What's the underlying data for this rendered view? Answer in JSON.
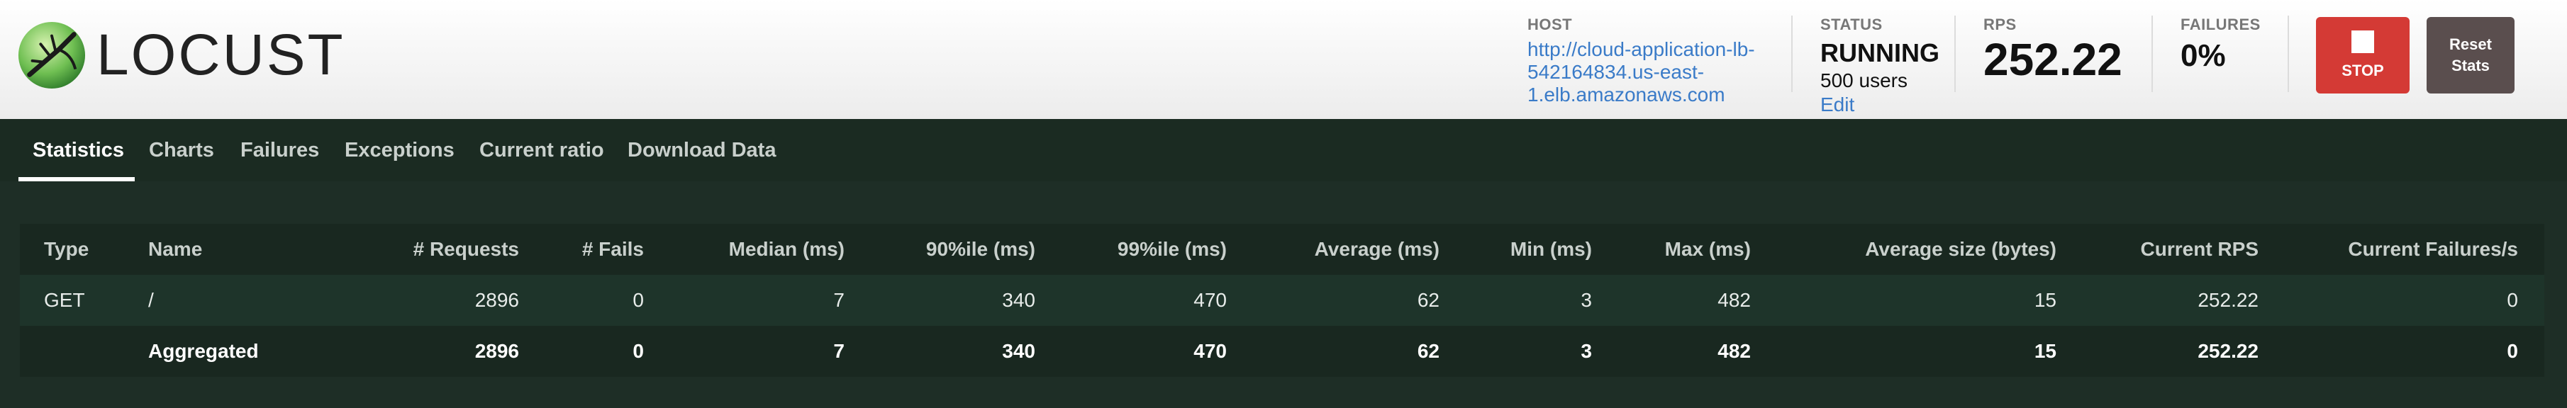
{
  "brand": {
    "name": "LOCUST"
  },
  "header": {
    "host": {
      "label": "HOST",
      "value": "http://cloud-application-lb-542164834.us-east-1.elb.amazonaws.com"
    },
    "status": {
      "label": "STATUS",
      "value": "RUNNING",
      "users": "500 users",
      "edit": "Edit"
    },
    "rps": {
      "label": "RPS",
      "value": "252.22"
    },
    "failures": {
      "label": "FAILURES",
      "value": "0%"
    },
    "stop_label": "STOP",
    "reset_label": "Reset\nStats"
  },
  "tabs": [
    {
      "label": "Statistics",
      "active": true
    },
    {
      "label": "Charts"
    },
    {
      "label": "Failures"
    },
    {
      "label": "Exceptions"
    },
    {
      "label": "Current ratio"
    },
    {
      "label": "Download Data"
    }
  ],
  "table": {
    "columns": [
      "Type",
      "Name",
      "# Requests",
      "# Fails",
      "Median (ms)",
      "90%ile (ms)",
      "99%ile (ms)",
      "Average (ms)",
      "Min (ms)",
      "Max (ms)",
      "Average size (bytes)",
      "Current RPS",
      "Current Failures/s"
    ],
    "rows": [
      [
        "GET",
        "/",
        "2896",
        "0",
        "7",
        "340",
        "470",
        "62",
        "3",
        "482",
        "15",
        "252.22",
        "0"
      ],
      [
        "",
        "Aggregated",
        "2896",
        "0",
        "7",
        "340",
        "470",
        "62",
        "3",
        "482",
        "15",
        "252.22",
        "0"
      ]
    ]
  },
  "colors": {
    "accent_link": "#3a7bc8",
    "stop": "#d43a35",
    "reset": "#5a4e4e",
    "background": "#1e2e26"
  }
}
